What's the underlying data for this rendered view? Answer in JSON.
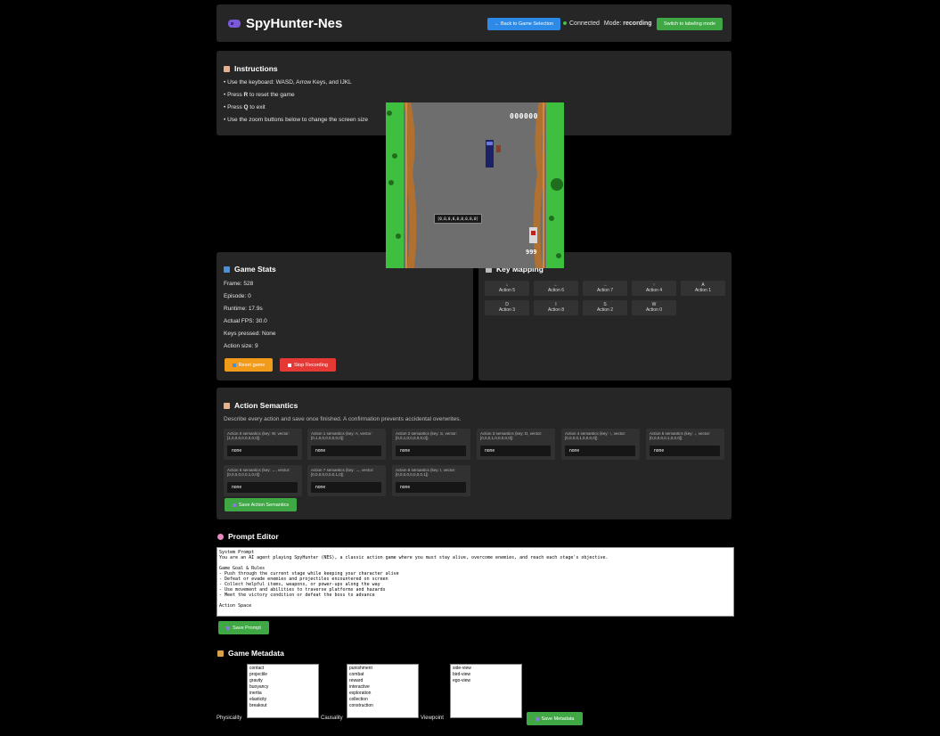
{
  "header": {
    "title": "SpyHunter-Nes",
    "back_label": "← Back to Game Selection",
    "status": "Connected",
    "mode_prefix": "Mode:",
    "mode_value": "recording",
    "switch_label": "Switch to labeling mode"
  },
  "instructions": {
    "title": "Instructions",
    "items": [
      "• Use the keyboard: WASD, Arrow Keys, and IJKL",
      "• Press R to reset the game",
      "• Press Q to exit",
      "• Use the zoom buttons below to change the screen size"
    ]
  },
  "game_screen": {
    "score": "000000",
    "overlay": "[0,0,0,0,0,0,0,0,0]",
    "counter": "999"
  },
  "stats": {
    "title": "Game Stats",
    "lines": [
      "Frame: 528",
      "Episode: 0",
      "Runtime: 17.9s",
      "Actual FPS: 30.0",
      "Keys pressed: None",
      "Action size: 9"
    ],
    "reset_label": "Reset game",
    "stop_label": "Stop Recording"
  },
  "keymap": {
    "title": "Key Mapping",
    "cells": [
      {
        "key": "↓",
        "action": "Action 5"
      },
      {
        "key": "←",
        "action": "Action 6"
      },
      {
        "key": "→",
        "action": "Action 7"
      },
      {
        "key": "↑",
        "action": "Action 4"
      },
      {
        "key": "A",
        "action": "Action 1"
      },
      {
        "key": "D",
        "action": "Action 3"
      },
      {
        "key": "I",
        "action": "Action 8"
      },
      {
        "key": "S",
        "action": "Action 2"
      },
      {
        "key": "W",
        "action": "Action 0"
      }
    ]
  },
  "semantics": {
    "title": "Action Semantics",
    "description": "Describe every action and save once finished. A confirmation prevents accidental overwrites.",
    "items": [
      {
        "label": "Action 0 semantics (key: W, vector: [1,0,0,0,0,0,0,0,0])",
        "value": "none"
      },
      {
        "label": "Action 1 semantics (key: A, vector: [0,1,0,0,0,0,0,0,0])",
        "value": "none"
      },
      {
        "label": "Action 2 semantics (key: S, vector: [0,0,1,0,0,0,0,0,0])",
        "value": "none"
      },
      {
        "label": "Action 3 semantics (key: D, vector: [0,0,0,1,0,0,0,0,0])",
        "value": "none"
      },
      {
        "label": "Action 4 semantics (key: ↑, vector: [0,0,0,0,1,0,0,0,0])",
        "value": "none"
      },
      {
        "label": "Action 5 semantics (key: ↓, vector: [0,0,0,0,0,1,0,0,0])",
        "value": "none"
      },
      {
        "label": "Action 6 semantics (key: ←, vector: [0,0,0,0,0,0,1,0,0])",
        "value": "none"
      },
      {
        "label": "Action 7 semantics (key: →, vector: [0,0,0,0,0,0,0,1,0])",
        "value": "none"
      },
      {
        "label": "Action 8 semantics (key: I, vector: [0,0,0,0,0,0,0,0,1])",
        "value": "none"
      }
    ],
    "save_label": "Save Action Semantics"
  },
  "prompt_editor": {
    "title": "Prompt Editor",
    "text": "System Prompt\nYou are an AI agent playing SpyHunter (NES), a classic action game where you must stay alive, overcome enemies, and reach each stage's objective.\n\nGame Goal & Rules\n- Push through the current stage while keeping your character alive\n- Defeat or evade enemies and projectiles encountered on screen\n- Collect helpful items, weapons, or power-ups along the way\n- Use movement and abilities to traverse platforms and hazards\n- Meet the victory condition or defeat the boss to advance\n\nAction Space",
    "save_label": "Save Prompt"
  },
  "metadata": {
    "title": "Game Metadata",
    "physicality_label": "Physicality",
    "physicality": [
      "contact",
      "projectile",
      "gravity",
      "buoyancy",
      "inertia",
      "elasticity",
      "breakout"
    ],
    "causality_label": "Causality",
    "causality": [
      "punishment",
      "combat",
      "reward",
      "interactive",
      "exploration",
      "collection",
      "construction"
    ],
    "viewpoint_label": "Viewpoint",
    "viewpoint": [
      "side-view",
      "bird-view",
      "ego-view"
    ],
    "save_label": "Save Metadata"
  }
}
